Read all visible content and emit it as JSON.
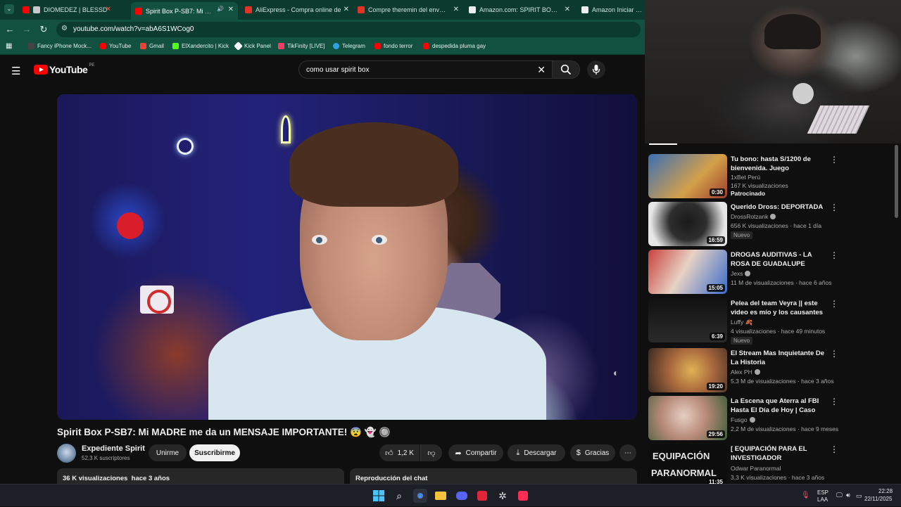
{
  "browser": {
    "tabs": [
      {
        "label": "DIOMEDEZ | BLESSD",
        "color": "#e0312b",
        "close": "✕"
      },
      {
        "label": "Spirit Box P-SB7: Mi MADRE",
        "color": "#ff0000",
        "close": "✕",
        "audio": "🔊"
      },
      {
        "label": "AliExpress - Compra online de",
        "color": "#e43225",
        "close": "✕"
      },
      {
        "label": "Compre theremin del envío gra",
        "color": "#e43225",
        "close": "✕"
      },
      {
        "label": "Amazon.com: SPIRIT BOX Mini",
        "color": "#f0f0f0",
        "close": "✕"
      },
      {
        "label": "Amazon Iniciar sesión",
        "color": "#f0f0f0",
        "close": ""
      }
    ],
    "url": "youtube.com/watch?v=abA6S1WCog0",
    "bookmarks": [
      {
        "label": "Fancy iPhone Mock...",
        "color": "#444444"
      },
      {
        "label": "YouTube",
        "color": "#ff0000"
      },
      {
        "label": "Gmail",
        "color": "#ea4335"
      },
      {
        "label": "ElXandercito | Kick",
        "color": "#53fc18"
      },
      {
        "label": "Kick Panel",
        "color": "#ffffff"
      },
      {
        "label": "TikFinity [LIVE]",
        "color": "#ff3b6b"
      },
      {
        "label": "Telegram",
        "color": "#2aa3df"
      },
      {
        "label": "fondo terror",
        "color": "#ff0000"
      },
      {
        "label": "despedida pluma gay",
        "color": "#ff0000"
      }
    ]
  },
  "youtube": {
    "logo": "YouTube",
    "region": "PE",
    "search_query": "como usar spirit box",
    "video": {
      "title": "Spirit Box P-SB7: Mi MADRE me da un MENSAJE IMPORTANTE! 😨 👻 🔘",
      "channel": "Expediente Spirit",
      "subscribers": "52,3 K suscriptores",
      "join_label": "Unirme",
      "subscribe_label": "Suscribirme",
      "likes": "1,2 K",
      "share_label": "Compartir",
      "download_label": "Descargar",
      "thanks_label": "Gracias",
      "views_info": "36 K visualizaciones  hace 3 años",
      "chat_replay": "Reproducción del chat"
    },
    "recommendations": [
      {
        "title": "Tu bono: hasta S/1200 de bienvenida. Juego responsabl...",
        "channel": "1xBet Perú",
        "meta": "167 K visualizaciones",
        "sponsor": "Patrocinado",
        "duration": "0:30",
        "thumb_a": "#3b6fb3",
        "thumb_b": "#d4a14b"
      },
      {
        "title": "Querido Dross: DEPORTADA",
        "channel": "DrossRotzank",
        "meta": "656 K visualizaciones · hace 1 día",
        "badge": "Nuevo",
        "duration": "16:59",
        "thumb_a": "#1a1a1a",
        "thumb_b": "#e6e6e6",
        "verified": true
      },
      {
        "title": "DROGAS AUDITIVAS - LA ROSA DE GUADALUPE",
        "channel": "Jexs",
        "meta": "11 M de visualizaciones · hace 6 años",
        "duration": "15:05",
        "thumb_a": "#c7413c",
        "thumb_b": "#3a6cc9",
        "verified": true
      },
      {
        "title": "Pelea del team Veyra || este video es mío y los causantes d...",
        "channel": "Luffy 🍂",
        "meta": "4 visualizaciones · hace 49 minutos",
        "badge": "Nuevo",
        "duration": "6:39",
        "thumb_a": "#111111",
        "thumb_b": "#2b2b2b"
      },
      {
        "title": "El Stream Mas Inquietante De La Historia",
        "channel": "Alex PH",
        "meta": "5,3 M de visualizaciones · hace 3 años",
        "duration": "19:20",
        "thumb_a": "#e0b255",
        "thumb_b": "#6b3a2a",
        "verified": true
      },
      {
        "title": "La Escena que Aterra al FBI Hasta El Día de Hoy | Caso Joe...",
        "channel": "Fusgo",
        "meta": "2,2 M de visualizaciones · hace 9 meses",
        "duration": "29:56",
        "thumb_a": "#d9c4b7",
        "thumb_b": "#3d5d3a",
        "verified": true
      },
      {
        "title": "[ EQUIPACIÓN PARA EL INVESTIGADOR PARANORMAL ]",
        "channel": "Odwar Paranormal",
        "meta": "3,3 K visualizaciones · hace 3 años",
        "duration": "11:35",
        "thumb_a": "#0d0d0d",
        "thumb_b": "#e5e5e5",
        "thumb_text_1": "EQUIPACIÓN",
        "thumb_text_2": "PARANORMAL"
      }
    ]
  },
  "taskbar": {
    "lang_1": "ESP",
    "lang_2": "LAA",
    "time": "22:28",
    "date": "22/11/2025"
  },
  "colors": {
    "browser_frame": "#0b3a2f",
    "browser_toolbar": "#12503f",
    "yt_bg": "#0f0f0f",
    "yt_red": "#ff0000"
  }
}
